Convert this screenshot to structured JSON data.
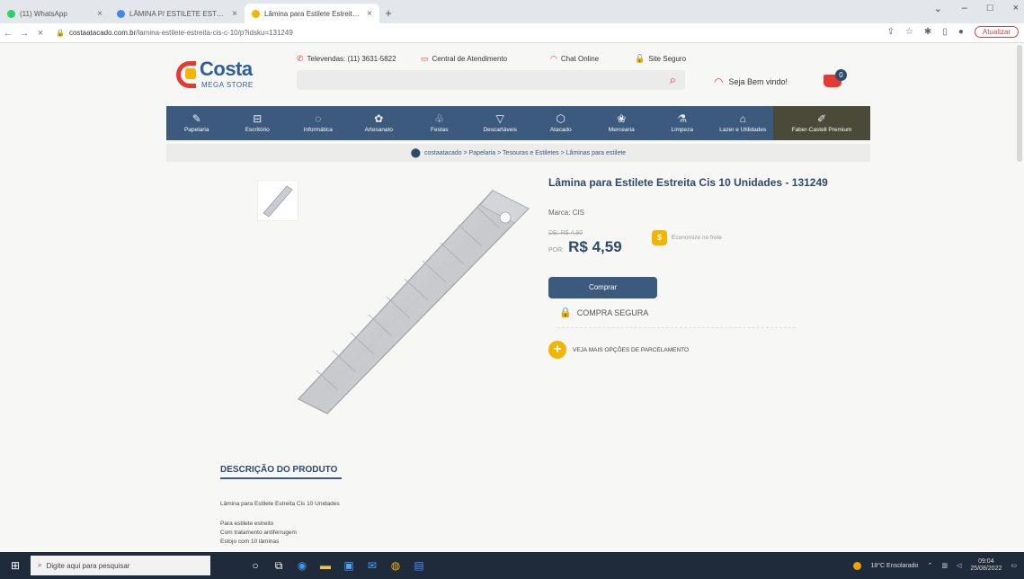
{
  "browser": {
    "tabs": [
      {
        "label": "(11) WhatsApp",
        "favicon_color": "#25d366"
      },
      {
        "label": "LÂMINA P/ ESTILETE ESTREITA -",
        "favicon_color": "#4285f4"
      },
      {
        "label": "Lâmina para Estilete Estreita Cis",
        "favicon_color": "#f4b400"
      }
    ],
    "url_domain": "costaatacado.com.br",
    "url_path": "/lamina-estilete-estreita-cis-c-10/p?idsku=131249",
    "update_label": "Atualizar"
  },
  "header": {
    "logo_name": "Costa",
    "logo_sub": "MEGA STORE",
    "televendas": "Televendas: (11) 3631-5822",
    "atendimento": "Central de Atendimento",
    "chat": "Chat Online",
    "site_seguro": "Site Seguro",
    "welcome": "Seja Bem vindo!",
    "cart_count": "0",
    "brand_color": "#2d5fa0",
    "accent_color": "#e53935"
  },
  "menu": [
    {
      "label": "Papelaria",
      "icon": "pencil-icon"
    },
    {
      "label": "Escritório",
      "icon": "stapler-icon"
    },
    {
      "label": "Informática",
      "icon": "mouse-icon"
    },
    {
      "label": "Artesanato",
      "icon": "yarn-icon"
    },
    {
      "label": "Festas",
      "icon": "balloon-icon"
    },
    {
      "label": "Descartáveis",
      "icon": "cup-icon"
    },
    {
      "label": "Atacado",
      "icon": "box-icon"
    },
    {
      "label": "Mercearia",
      "icon": "bread-icon"
    },
    {
      "label": "Limpeza",
      "icon": "spray-icon"
    },
    {
      "label": "Lazer e Utilidades",
      "icon": "tent-icon"
    },
    {
      "label": "Faber-Castell Premium",
      "icon": "pens-icon"
    }
  ],
  "breadcrumb": "costaatacado > Papelaria > Tesouras e Estiletes > Lâminas para estilete",
  "product": {
    "title": "Lâmina para Estilete Estreita Cis 10 Unidades - 131249",
    "brand": "Marca: CIS",
    "old_price": "DE: R$ 4,90",
    "price_prefix": "POR:",
    "price": "R$ 4,59",
    "shipping": "Economize no frete",
    "buy_label": "Comprar",
    "secure_label": "COMPRA SEGURA",
    "installments_label": "VEJA MAIS OPÇÕES DE PARCELAMENTO"
  },
  "description": {
    "title": "DESCRIÇÃO DO PRODUTO",
    "intro": "Lâmina para Estilete Estreita Cis 10 Unidades",
    "items": [
      "Para estilete estreito",
      "Com tratamento antiferrugem",
      "Estojo com 10 lâminas"
    ]
  },
  "taskbar": {
    "search_placeholder": "Digite aqui para pesquisar",
    "weather": "18°C Ensolarado",
    "time": "09:04",
    "date": "25/08/2022"
  }
}
